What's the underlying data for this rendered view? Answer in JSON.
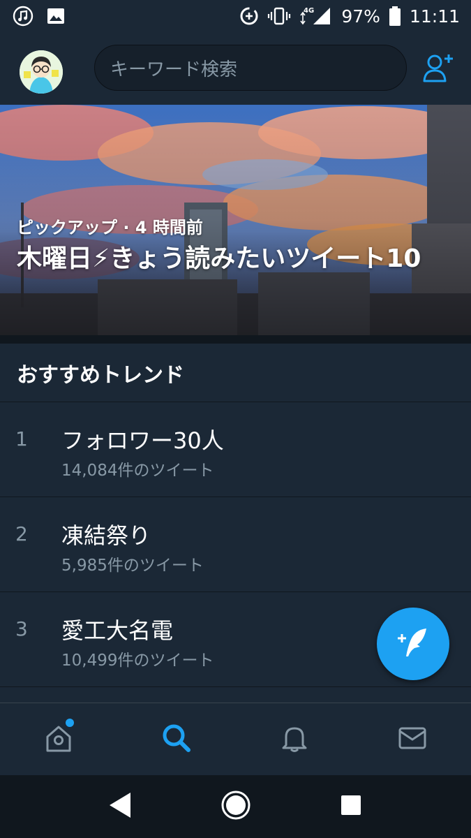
{
  "status_bar": {
    "battery": "97%",
    "time": "11:11",
    "network": "4G",
    "icons": [
      "music-icon",
      "image-icon",
      "data-saver-icon",
      "vibrate-icon",
      "signal-icon",
      "battery-icon"
    ]
  },
  "header": {
    "search_placeholder": "キーワード検索",
    "avatar_icon": "avatar",
    "add_user_icon": "add-user-icon"
  },
  "hero": {
    "meta": "ピックアップ · 4 時間前",
    "title": "木曜日⚡きょう読みたいツイート10"
  },
  "trends": {
    "header": "おすすめトレンド",
    "items": [
      {
        "rank": "1",
        "name": "フォロワー30人",
        "count": "14,084件のツイート"
      },
      {
        "rank": "2",
        "name": "凍結祭り",
        "count": "5,985件のツイート"
      },
      {
        "rank": "3",
        "name": "愛工大名電",
        "count": "10,499件のツイート"
      }
    ]
  },
  "fab": {
    "icon": "compose-tweet-icon"
  },
  "tabs": [
    {
      "name": "home",
      "icon": "home-icon",
      "active": false,
      "has_dot": true
    },
    {
      "name": "search",
      "icon": "search-icon",
      "active": true
    },
    {
      "name": "notifications",
      "icon": "bell-icon",
      "active": false
    },
    {
      "name": "messages",
      "icon": "mail-icon",
      "active": false
    }
  ],
  "colors": {
    "accent": "#1da1f2",
    "background": "#15202b",
    "surface": "#1b2836",
    "muted_text": "#8899a6"
  }
}
